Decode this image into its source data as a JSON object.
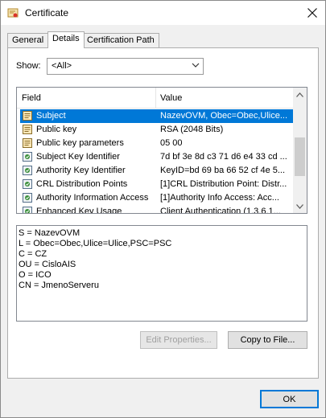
{
  "window": {
    "title": "Certificate"
  },
  "tabs": [
    {
      "label": "General"
    },
    {
      "label": "Details"
    },
    {
      "label": "Certification Path"
    }
  ],
  "show": {
    "label": "Show:",
    "selected": "<All>"
  },
  "list": {
    "columns": {
      "field": "Field",
      "value": "Value"
    },
    "rows": [
      {
        "field": "Subject",
        "value": "NazevOVM, Obec=Obec,Ulice...",
        "icon": "certificate-field-icon",
        "selected": true
      },
      {
        "field": "Public key",
        "value": "RSA (2048 Bits)",
        "icon": "certificate-field-icon"
      },
      {
        "field": "Public key parameters",
        "value": "05 00",
        "icon": "certificate-field-icon"
      },
      {
        "field": "Subject Key Identifier",
        "value": "7d bf 3e 8d c3 71 d6 e4 33 cd ...",
        "icon": "certificate-extension-icon"
      },
      {
        "field": "Authority Key Identifier",
        "value": "KeyID=bd 69 ba 66 52 cf 4e 5...",
        "icon": "certificate-extension-icon"
      },
      {
        "field": "CRL Distribution Points",
        "value": "[1]CRL Distribution Point: Distr...",
        "icon": "certificate-extension-icon"
      },
      {
        "field": "Authority Information Access",
        "value": "[1]Authority Info Access: Acc...",
        "icon": "certificate-extension-icon"
      },
      {
        "field": "Enhanced Key Usage",
        "value": "Client Authentication (1.3.6.1...",
        "icon": "certificate-extension-icon"
      }
    ]
  },
  "details": [
    "S = NazevOVM",
    "L = Obec=Obec,Ulice=Ulice,PSC=PSC",
    "C = CZ",
    "OU = CisloAIS",
    "O = ICO",
    "CN = JmenoServeru"
  ],
  "buttons": {
    "edit_properties": "Edit Properties...",
    "copy_to_file": "Copy to File...",
    "ok": "OK"
  }
}
